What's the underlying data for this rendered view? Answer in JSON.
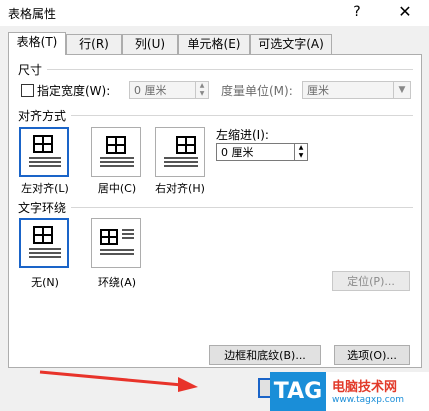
{
  "window": {
    "title": "表格属性",
    "help": "?",
    "close": "✕"
  },
  "tabs": [
    {
      "label": "表格(T)"
    },
    {
      "label": "行(R)"
    },
    {
      "label": "列(U)"
    },
    {
      "label": "单元格(E)"
    },
    {
      "label": "可选文字(A)"
    }
  ],
  "size": {
    "section": "尺寸",
    "pref_width_label": "指定宽度(W):",
    "pref_width_value": "0 厘米",
    "unit_label": "度量单位(M):",
    "unit_value": "厘米"
  },
  "alignment": {
    "section": "对齐方式",
    "options": [
      {
        "label": "左对齐(L)"
      },
      {
        "label": "居中(C)"
      },
      {
        "label": "右对齐(H)"
      }
    ],
    "indent_label": "左缩进(I):",
    "indent_value": "0 厘米"
  },
  "wrapping": {
    "section": "文字环绕",
    "options": [
      {
        "label": "无(N)"
      },
      {
        "label": "环绕(A)"
      }
    ],
    "position_button": "定位(P)..."
  },
  "buttons": {
    "borders": "边框和底纹(B)...",
    "options": "选项(O)..."
  },
  "watermark": {
    "tag": "TAG",
    "line1": "电脑技术网",
    "line2": "www.tagxp.com"
  },
  "colors": {
    "accent": "#1a64c8",
    "arrow": "#e8332a"
  }
}
